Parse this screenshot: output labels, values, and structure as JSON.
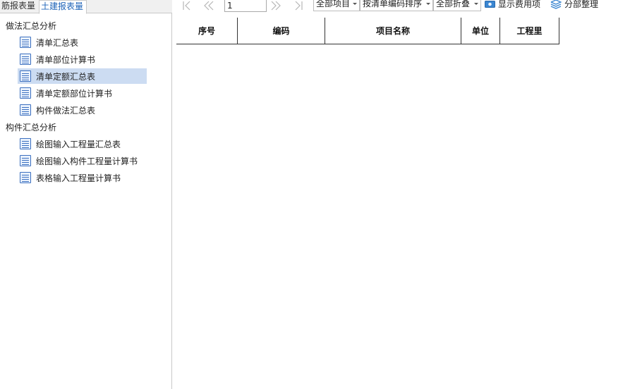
{
  "tabs": [
    "筋报表量",
    "土建报表量"
  ],
  "tree": {
    "groups": [
      {
        "label": "做法汇总分析",
        "items": [
          "清单汇总表",
          "清单部位计算书",
          "清单定额汇总表",
          "清单定额部位计算书",
          "构件做法汇总表"
        ]
      },
      {
        "label": "构件汇总分析",
        "items": [
          "绘图输入工程量汇总表",
          "绘图输入构件工程量计算书",
          "表格输入工程量计算书"
        ]
      }
    ],
    "selected": "清单定额汇总表"
  },
  "toolbar": {
    "page_value": "1",
    "project_filter": "全部项目",
    "sort_mode": "按清单编码排序",
    "fold_mode": "全部折叠",
    "show_cost_label": "显示费用项",
    "organize_label": "分部整理"
  },
  "table": {
    "columns": [
      "序号",
      "编码",
      "项目名称",
      "单位",
      "工程里"
    ]
  },
  "colors": {
    "accent": "#1e63b8",
    "selected_row": "#ccdcf2"
  }
}
